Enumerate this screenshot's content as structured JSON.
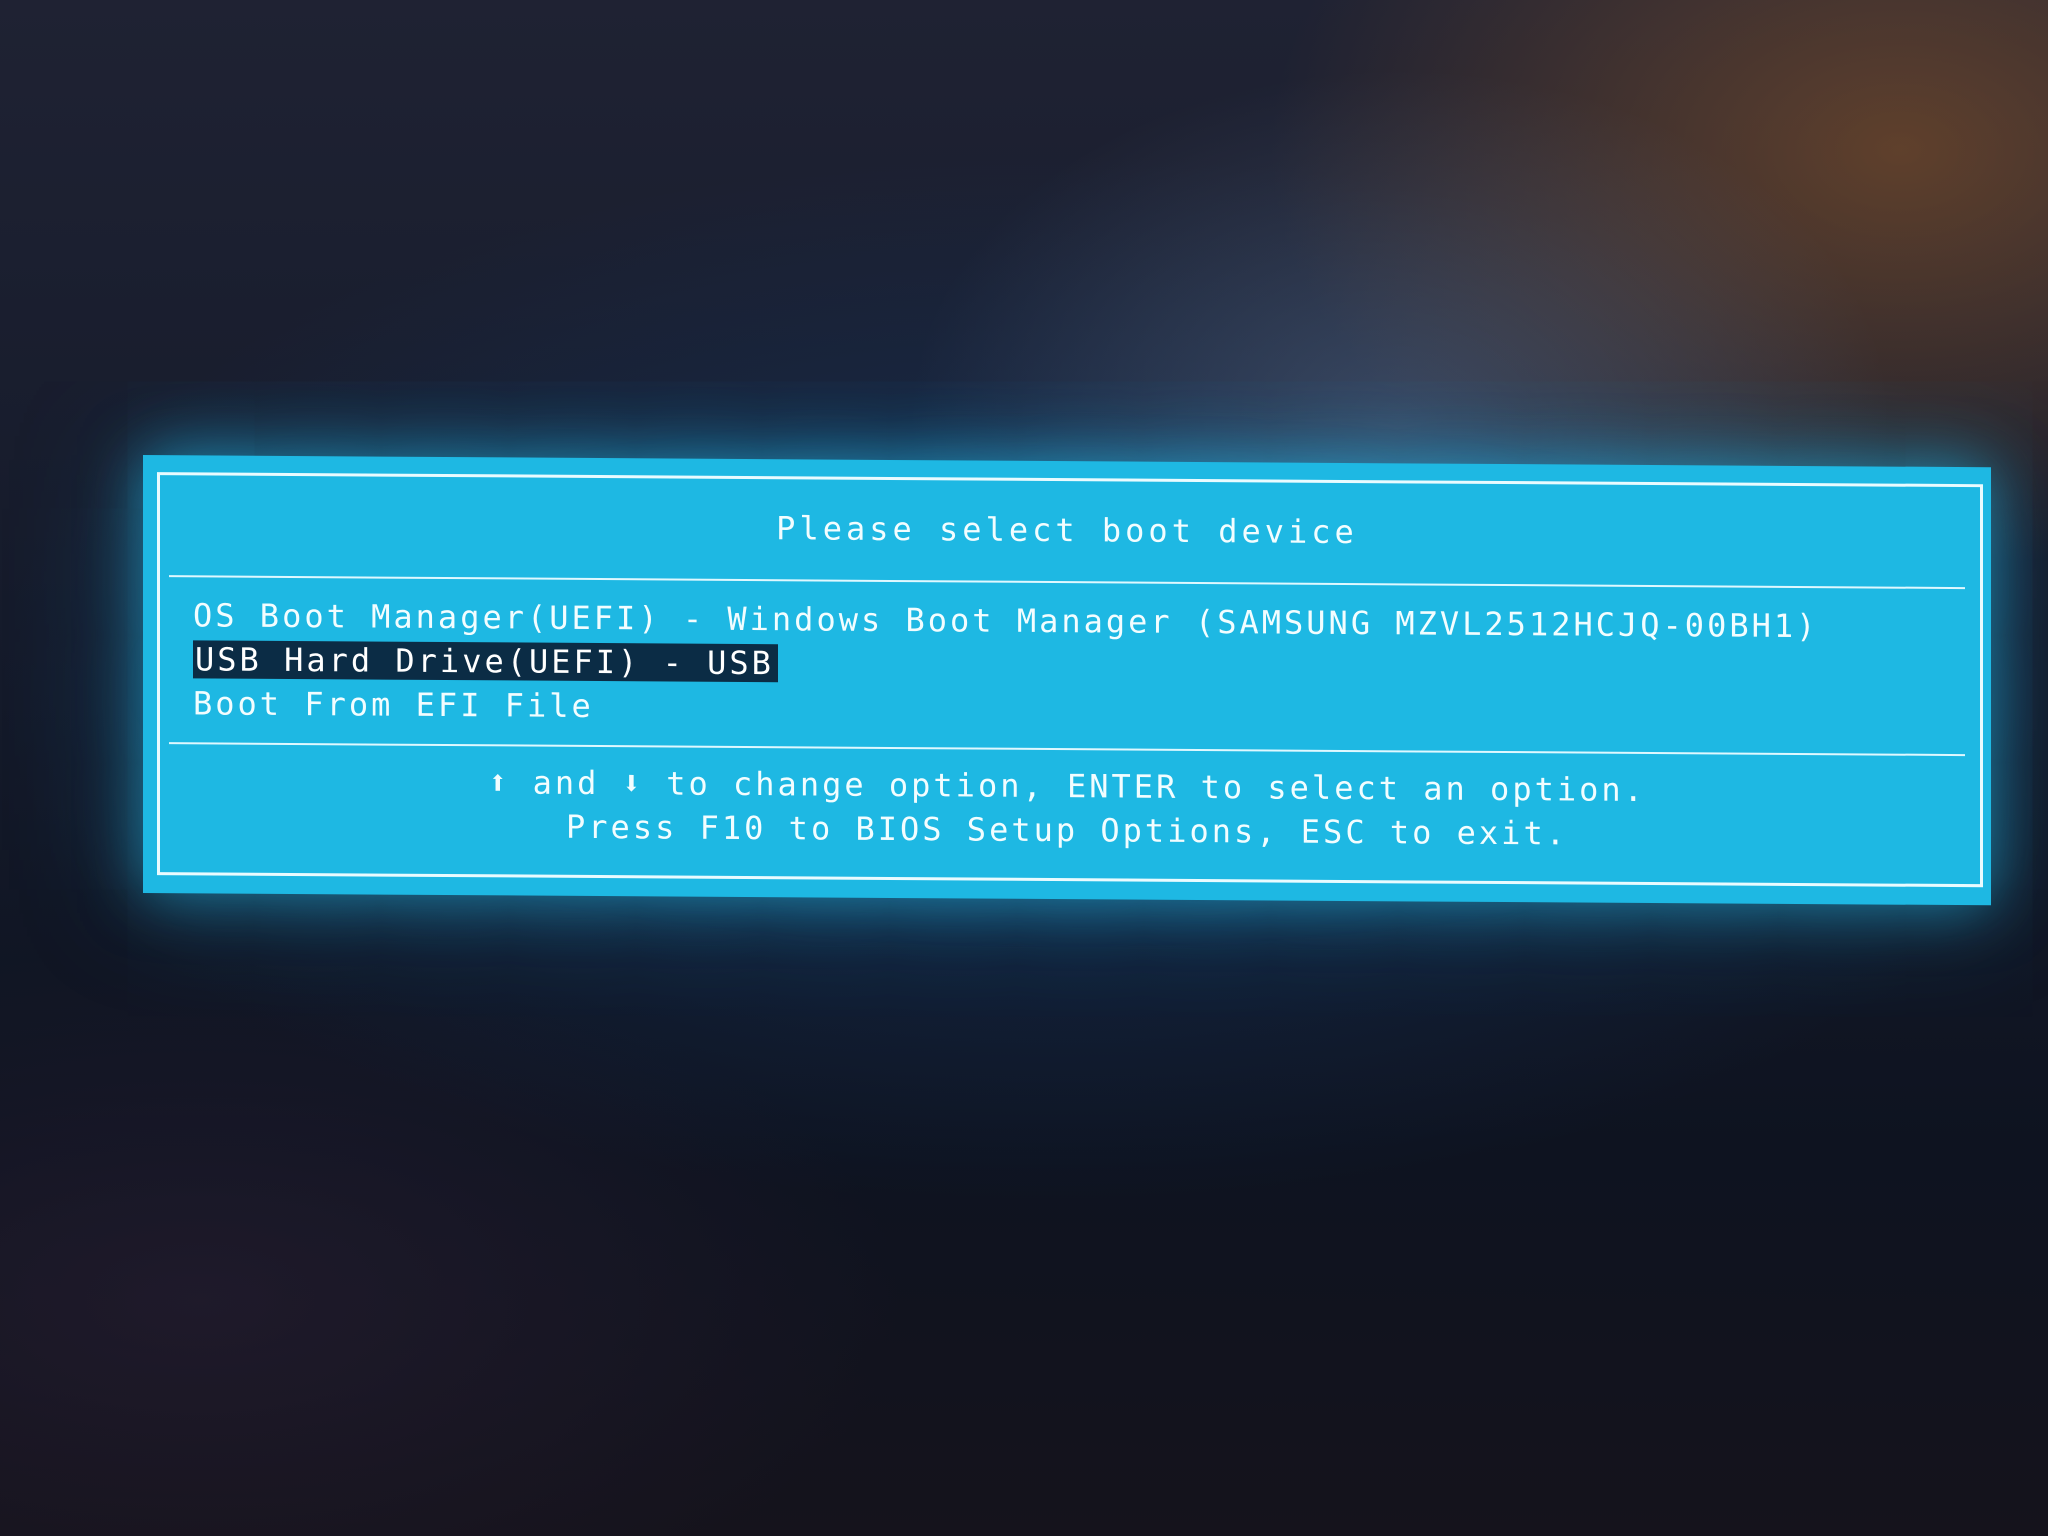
{
  "dialog": {
    "title": "Please select boot device",
    "items": [
      {
        "label": "OS Boot Manager(UEFI) - Windows Boot Manager (SAMSUNG MZVL2512HCJQ-00BH1)"
      },
      {
        "label": "USB Hard Drive(UEFI) -  USB",
        "selected": true
      },
      {
        "label": "Boot From EFI File"
      }
    ],
    "help": {
      "up_arrow": "⬆",
      "and_text": " and ",
      "down_arrow": "⬇",
      "line1_rest": " to change option, ENTER to select an option.",
      "line2": "Press F10 to BIOS Setup Options, ESC to exit."
    }
  },
  "colors": {
    "dialog_background": "#1eb8e3",
    "text": "#f2fdff",
    "selection_background": "#0b2c45"
  }
}
